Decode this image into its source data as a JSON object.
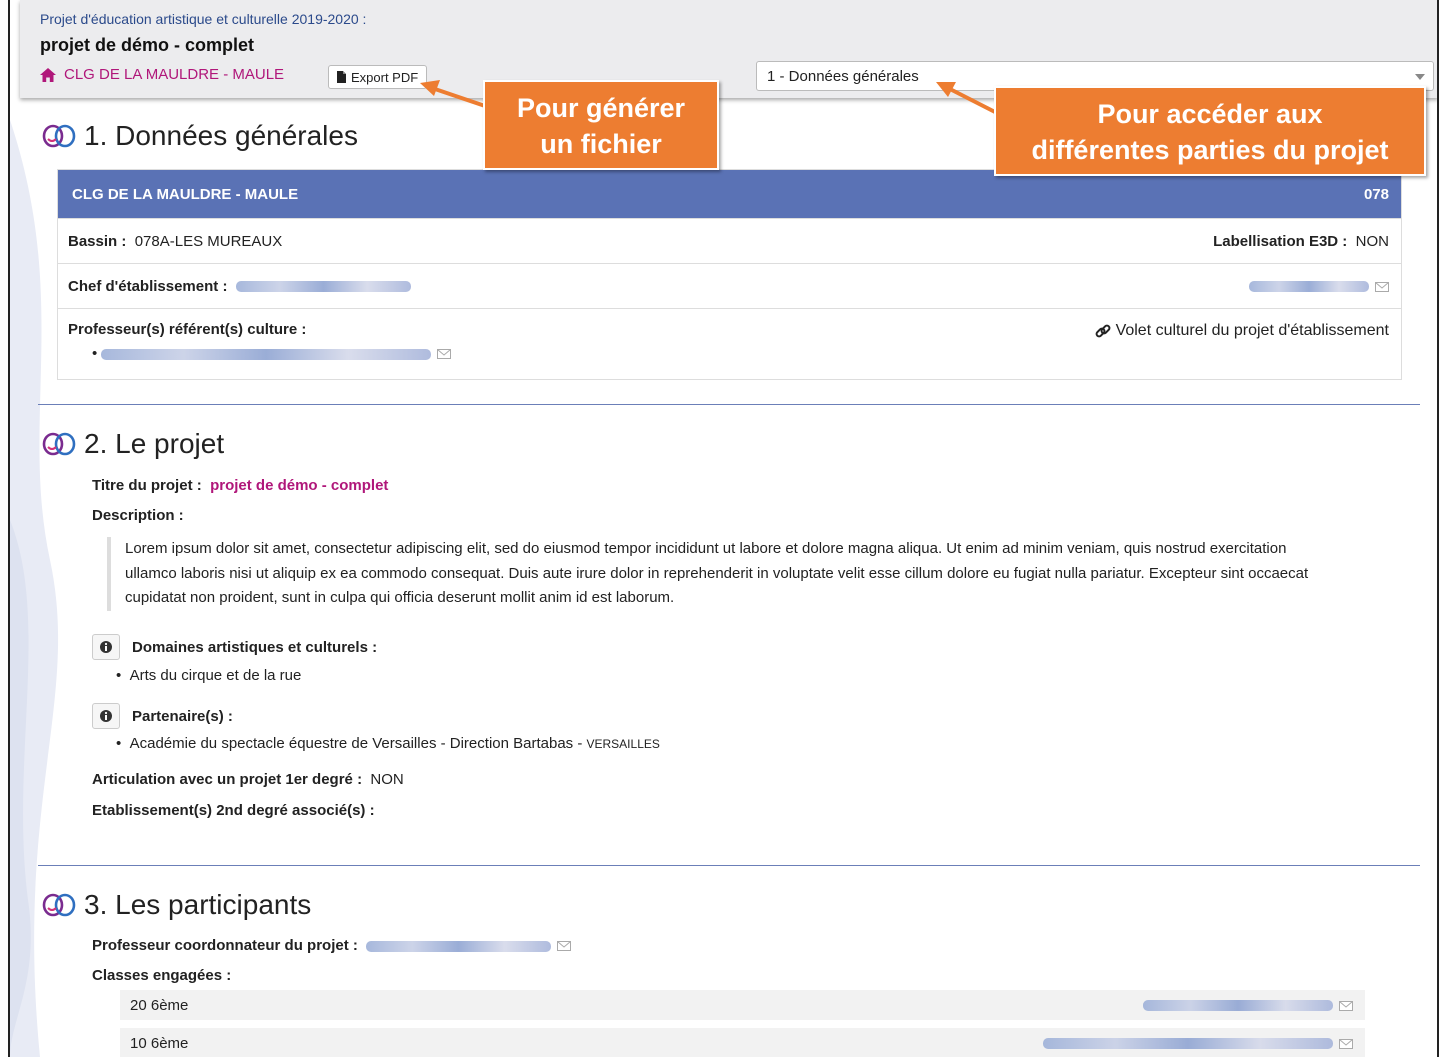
{
  "header": {
    "subtitle": "Projet d'éducation artistique et culturelle 2019-2020 :",
    "title": "projet de démo - complet",
    "school": "CLG DE LA MAULDRE - MAULE",
    "export_label": "Export PDF",
    "section_select": "1 - Données générales"
  },
  "callouts": {
    "left": [
      "Pour générer",
      "un fichier"
    ],
    "right": [
      "Pour accéder aux",
      "différentes parties du projet"
    ]
  },
  "section1": {
    "title": "1. Données générales",
    "card": {
      "school": "CLG DE LA MAULDRE - MAULE",
      "code": "078",
      "bassin_label": "Bassin :",
      "bassin_value": "078A-LES MUREAUX",
      "label_e3d_label": "Labellisation E3D :",
      "label_e3d_value": "NON",
      "chef_label": "Chef d'établissement :",
      "prof_label": "Professeur(s) référent(s) culture :",
      "volet_link": "Volet culturel du projet d'établissement"
    }
  },
  "section2": {
    "title": "2. Le projet",
    "titre_label": "Titre du projet :",
    "titre_value": "projet de démo - complet",
    "description_label": "Description :",
    "description": "Lorem ipsum dolor sit amet, consectetur adipiscing elit, sed do eiusmod tempor incididunt ut labore et dolore magna aliqua. Ut enim ad minim veniam, quis nostrud exercitation ullamco laboris nisi ut aliquip ex ea commodo consequat. Duis aute irure dolor in reprehenderit in voluptate velit esse cillum dolore eu fugiat nulla pariatur. Excepteur sint occaecat cupidatat non proident, sunt in culpa qui officia deserunt mollit anim id est laborum.",
    "domaines_label": "Domaines artistiques et culturels :",
    "domaines": [
      "Arts du cirque et de la rue"
    ],
    "partenaires_label": "Partenaire(s) :",
    "partenaire_name": "Académie du spectacle équestre de Versailles - Direction Bartabas - ",
    "partenaire_city": "VERSAILLES",
    "articulation_label": "Articulation avec un projet 1er degré :",
    "articulation_value": "NON",
    "etablissements_label": "Etablissement(s) 2nd degré associé(s) :"
  },
  "section3": {
    "title": "3. Les participants",
    "coordonnateur_label": "Professeur coordonnateur du projet :",
    "classes_label": "Classes engagées :",
    "classes": [
      "20 6ème",
      "10 6ème"
    ]
  },
  "colors": {
    "accent_magenta": "#b0177a",
    "card_header_blue": "#5a72b5",
    "callout_orange": "#ed7d31"
  }
}
